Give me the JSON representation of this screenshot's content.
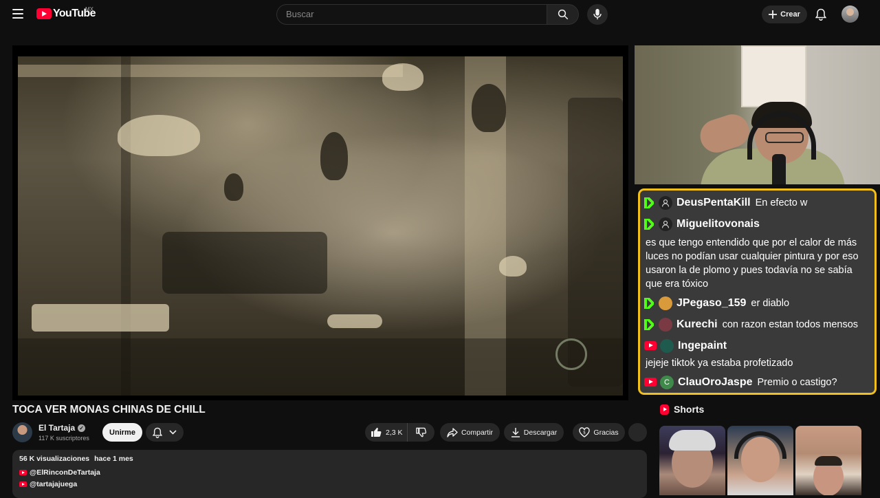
{
  "header": {
    "logo_text": "YouTube",
    "country_code": "MX",
    "search_placeholder": "Buscar",
    "create_label": "Crear"
  },
  "video": {
    "title": "TOCA VER MONAS CHINAS DE CHILL",
    "channel_name": "El Tartaja",
    "subscribers": "117 K suscriptores",
    "join_label": "Unirme",
    "likes": "2,3 K",
    "share_label": "Compartir",
    "download_label": "Descargar",
    "thanks_label": "Gracias"
  },
  "description": {
    "views": "56 K visualizaciones",
    "age": "hace 1 mes",
    "links": [
      "@ElRinconDeTartaja",
      "@tartajajuega"
    ]
  },
  "chat": {
    "messages": [
      {
        "platform": "kick",
        "user": "DeusPentaKill",
        "text": "En efecto w"
      },
      {
        "platform": "kick",
        "user": "Miguelitovonais",
        "text": "es que tengo entendido que por el calor de más luces no podían usar cualquier pintura y por eso usaron la de plomo y pues todavía no se sabía que era tóxico"
      },
      {
        "platform": "kick",
        "user": "JPegaso_159",
        "text": "er diablo"
      },
      {
        "platform": "kick",
        "user": "Kurechi",
        "text": "con razon estan todos mensos"
      },
      {
        "platform": "youtube",
        "user": "Ingepaint",
        "text": "jejeje tiktok ya estaba profetizado"
      },
      {
        "platform": "youtube",
        "user": "ClauOroJaspe",
        "avatar_letter": "C",
        "text": "Premio o castigo?"
      }
    ]
  },
  "shorts": {
    "label": "Shorts"
  },
  "colors": {
    "brand_red": "#ff0033",
    "chat_border": "#f2c01d",
    "kick_green": "#53fc18"
  }
}
